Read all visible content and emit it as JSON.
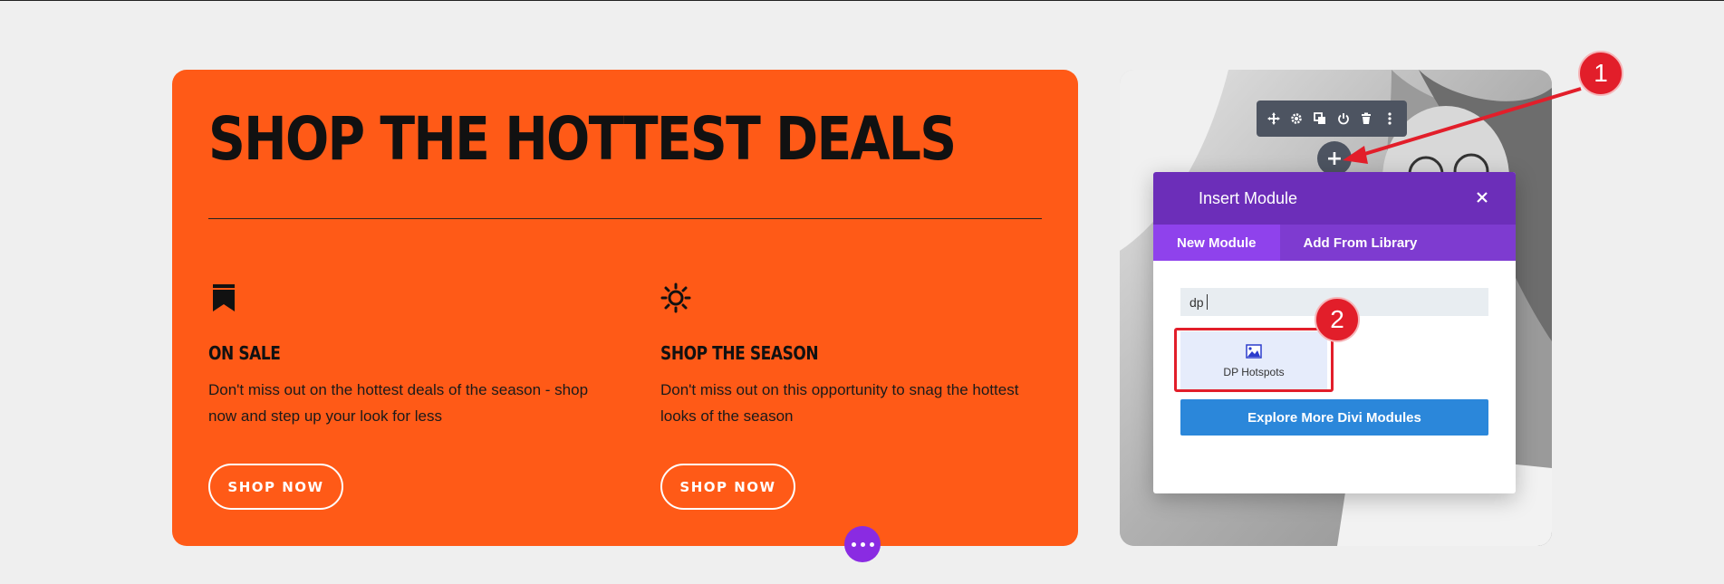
{
  "promo": {
    "title": "SHOP THE HOTTEST DEALS",
    "features": [
      {
        "icon": "bookmark-icon",
        "heading": "ON SALE",
        "text": "Don't miss out on the hottest deals of the season - shop now and step up your look for less",
        "button": "SHOP NOW"
      },
      {
        "icon": "sun-icon",
        "heading": "SHOP THE SEASON",
        "text": "Don't miss out on this opportunity to snag the hottest looks of the season",
        "button": "SHOP NOW"
      }
    ]
  },
  "toolbar": {
    "icons": [
      "move-icon",
      "gear-icon",
      "duplicate-icon",
      "power-icon",
      "trash-icon",
      "more-vertical-icon"
    ]
  },
  "add_button": {
    "label": "+"
  },
  "modal": {
    "title": "Insert Module",
    "tabs": [
      {
        "label": "New Module",
        "active": true
      },
      {
        "label": "Add From Library",
        "active": false
      }
    ],
    "search": {
      "value": "dp"
    },
    "results": [
      {
        "icon": "image-icon",
        "label": "DP Hotspots"
      }
    ],
    "explore_button": "Explore More Divi Modules"
  },
  "annotations": {
    "callout_1": "1",
    "callout_2": "2"
  },
  "colors": {
    "promo_bg": "#ff5a17",
    "modal_header": "#6c2eb9",
    "tab_bar": "#7e3bd0",
    "explore_button": "#2b87da",
    "annotation_red": "#e21e2a"
  }
}
